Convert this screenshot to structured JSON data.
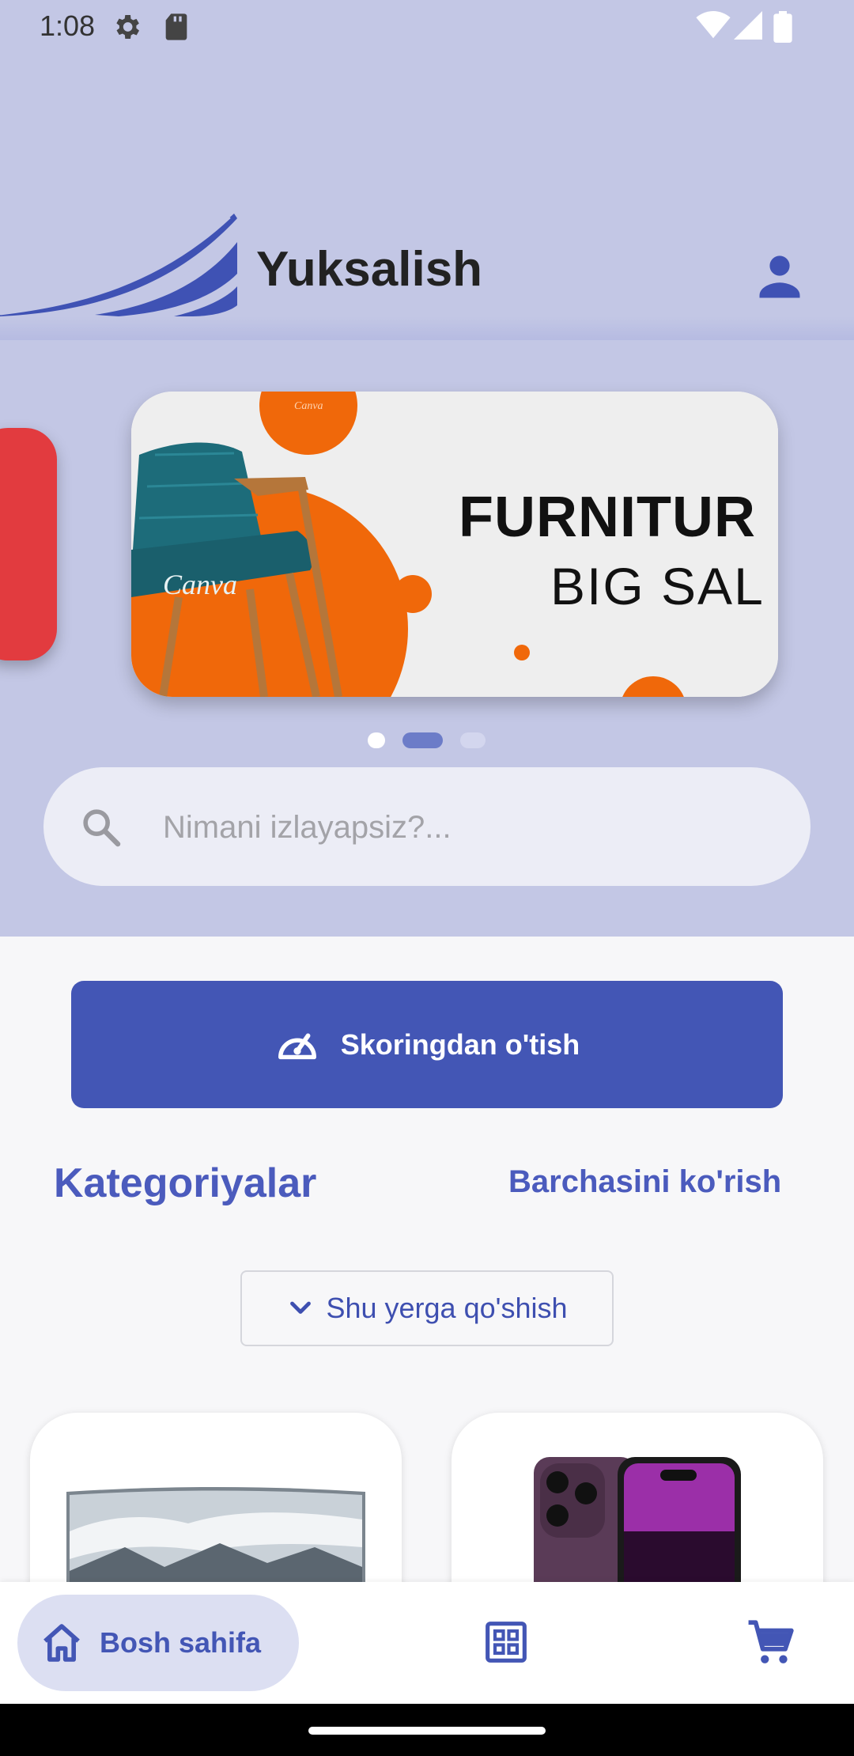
{
  "status_bar": {
    "time": "1:08",
    "icons": [
      "settings-icon",
      "sd-card-icon",
      "wifi-icon",
      "signal-icon",
      "battery-icon"
    ]
  },
  "header": {
    "brand": "Yuksalish",
    "profile_icon": "person-icon"
  },
  "banner": {
    "title": "FURNITUR",
    "subtitle": "BIG SAL",
    "watermark": "Canva",
    "active_slide": 2,
    "slide_count": 3
  },
  "search": {
    "placeholder": "Nimani izlayapsiz?..."
  },
  "scoring_button": {
    "label": "Skoringdan o'tish",
    "icon": "speedometer-icon"
  },
  "categories": {
    "title": "Kategoriyalar",
    "see_all": "Barchasini ko'rish",
    "add_here": "Shu yerga qo'shish"
  },
  "products": [
    {
      "image": "monitor-landscape-image"
    },
    {
      "image": "iphone-purple-image"
    }
  ],
  "bottom_nav": {
    "home_label": "Bosh sahifa",
    "home_icon": "home-icon",
    "catalog_icon": "grid-icon",
    "cart_icon": "cart-icon"
  },
  "colors": {
    "header_bg": "#c3c7e5",
    "primary": "#4356b5",
    "accent_text": "#4b5bbd",
    "side_card": "#e23b3f",
    "banner_orange": "#f0680a"
  }
}
